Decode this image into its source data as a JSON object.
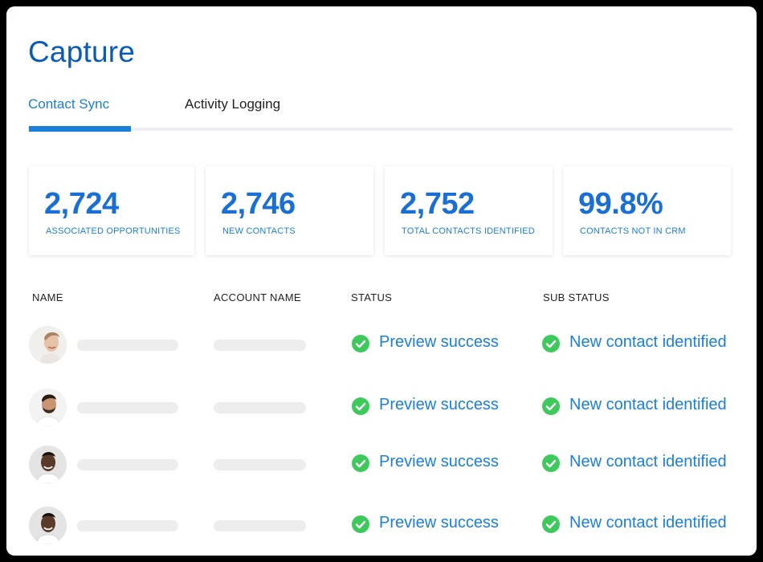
{
  "page": {
    "title": "Capture"
  },
  "tabs": [
    {
      "label": "Contact Sync",
      "active": true
    },
    {
      "label": "Activity Logging",
      "active": false
    }
  ],
  "stats": [
    {
      "value": "2,724",
      "label": "ASSOCIATED OPPORTUNITIES"
    },
    {
      "value": "2,746",
      "label": "NEW CONTACTS"
    },
    {
      "value": "2,752",
      "label": "TOTAL CONTACTS IDENTIFIED"
    },
    {
      "value": "99.8%",
      "label": "CONTACTS NOT IN CRM"
    }
  ],
  "table": {
    "columns": [
      "NAME",
      "ACCOUNT NAME",
      "STATUS",
      "SUB STATUS"
    ],
    "rows": [
      {
        "avatar": "woman-smiling-avatar",
        "status": "Preview success",
        "sub_status": "New contact identified"
      },
      {
        "avatar": "bearded-man-avatar",
        "status": "Preview success",
        "sub_status": "New contact identified"
      },
      {
        "avatar": "smiling-man-avatar",
        "status": "Preview success",
        "sub_status": "New contact identified"
      },
      {
        "avatar": "smiling-man-avatar",
        "status": "Preview success",
        "sub_status": "New contact identified"
      }
    ]
  },
  "colors": {
    "title": "#0a5ab8",
    "accent": "#1a7fd8",
    "success": "#3ec95c",
    "placeholder": "#ededed"
  },
  "icons": {
    "status_icon": "check-circle-icon"
  }
}
